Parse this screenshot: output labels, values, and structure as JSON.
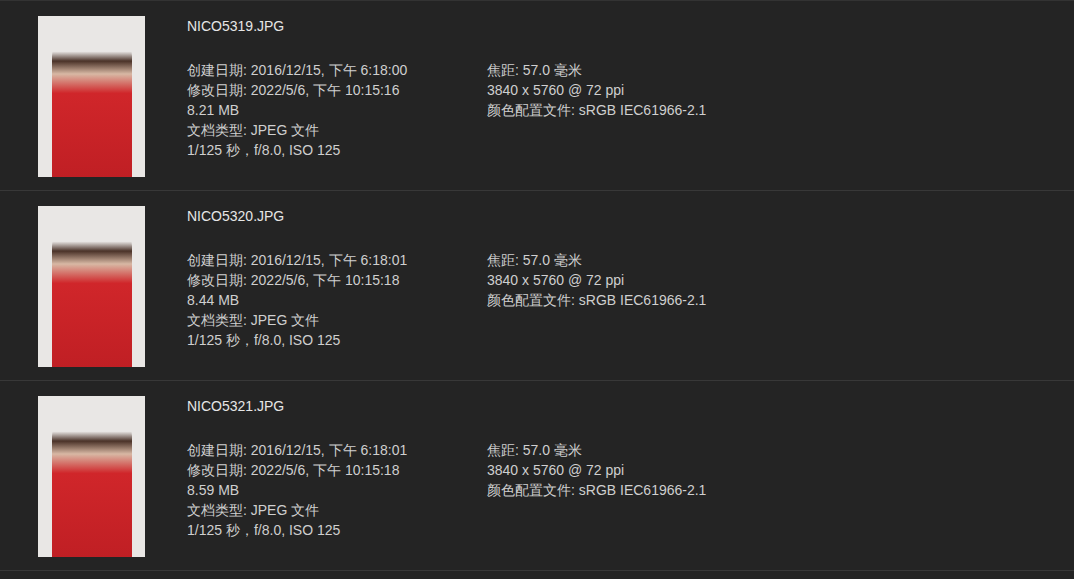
{
  "files": [
    {
      "name": "NICO5319.JPG",
      "details_left": [
        "创建日期: 2016/12/15, 下午 6:18:00",
        "修改日期: 2022/5/6, 下午 10:15:16",
        "8.21 MB",
        "文档类型: JPEG 文件",
        "1/125 秒，f/8.0, ISO 125"
      ],
      "details_right": [
        "焦距: 57.0 毫米",
        "3840 x 5760 @ 72 ppi",
        "颜色配置文件: sRGB IEC61966-2.1"
      ]
    },
    {
      "name": "NICO5320.JPG",
      "details_left": [
        "创建日期: 2016/12/15, 下午 6:18:01",
        "修改日期: 2022/5/6, 下午 10:15:18",
        "8.44 MB",
        "文档类型: JPEG 文件",
        "1/125 秒，f/8.0, ISO 125"
      ],
      "details_right": [
        "焦距: 57.0 毫米",
        "3840 x 5760 @ 72 ppi",
        "颜色配置文件: sRGB IEC61966-2.1"
      ]
    },
    {
      "name": "NICO5321.JPG",
      "details_left": [
        "创建日期: 2016/12/15, 下午 6:18:01",
        "修改日期: 2022/5/6, 下午 10:15:18",
        "8.59 MB",
        "文档类型: JPEG 文件",
        "1/125 秒，f/8.0, ISO 125"
      ],
      "details_right": [
        "焦距: 57.0 毫米",
        "3840 x 5760 @ 72 ppi",
        "颜色配置文件: sRGB IEC61966-2.1"
      ]
    }
  ]
}
